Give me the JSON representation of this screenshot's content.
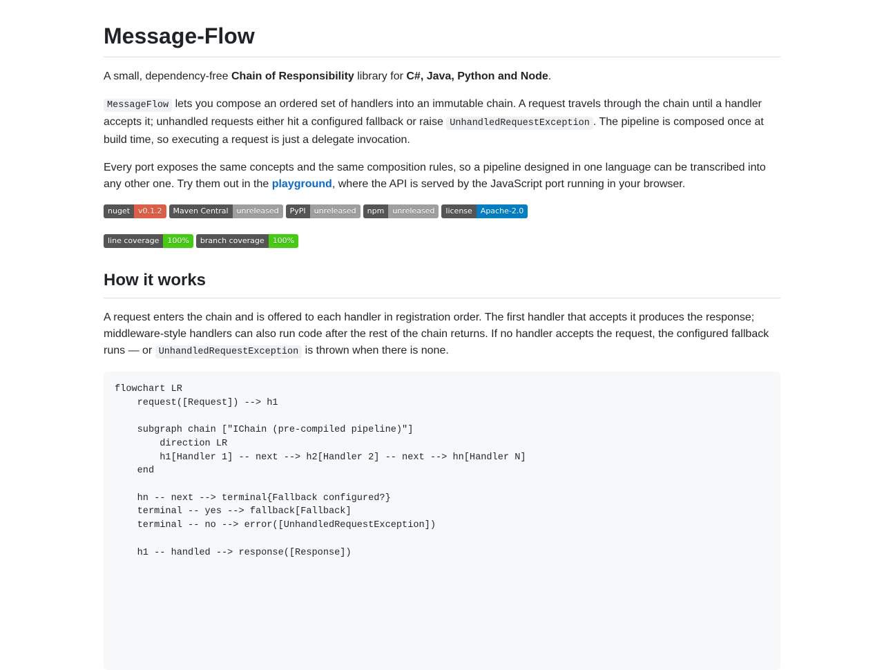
{
  "title": "Message-Flow",
  "intro": {
    "prefix": "A small, dependency-free ",
    "bold1": "Chain of Responsibility",
    "middle": " library for ",
    "bold2": "C#, Java, Python and Node",
    "suffix": "."
  },
  "para2": {
    "code1": "MessageFlow",
    "text1": " lets you compose an ordered set of handlers into an immutable chain. A request travels through the chain until a handler accepts it; unhandled requests either hit a configured fallback or raise ",
    "code2": "UnhandledRequestException",
    "text2": ". The pipeline is composed once at build time, so executing a request is just a delegate invocation."
  },
  "para3": {
    "text1": "Every port exposes the same concepts and the same composition rules, so a pipeline designed in one language can be transcribed into any other one. Try them out in the ",
    "link": "playground",
    "text2": ", where the API is served by the JavaScript port running in your browser."
  },
  "badges_row1": [
    {
      "label": "nuget",
      "value": "v0.1.2",
      "color": "#e05d44"
    },
    {
      "label": "Maven Central",
      "value": "unreleased",
      "color": "#9f9f9f"
    },
    {
      "label": "PyPI",
      "value": "unreleased",
      "color": "#9f9f9f"
    },
    {
      "label": "npm",
      "value": "unreleased",
      "color": "#9f9f9f"
    },
    {
      "label": "license",
      "value": "Apache-2.0",
      "color": "#007ec6"
    }
  ],
  "badges_row2": [
    {
      "label": "line coverage",
      "value": "100%",
      "color": "#4c1"
    },
    {
      "label": "branch coverage",
      "value": "100%",
      "color": "#4c1"
    }
  ],
  "section": {
    "heading": "How it works",
    "text1": "A request enters the chain and is offered to each handler in registration order. The first handler that accepts it produces the response; middleware-style handlers can also run code after the rest of the chain returns. If no handler accepts the request, the configured fallback runs — or ",
    "code": "UnhandledRequestException",
    "text2": " is thrown when there is none."
  },
  "code_block": "flowchart LR\n    request([Request]) --> h1\n\n    subgraph chain [\"IChain (pre-compiled pipeline)\"]\n        direction LR\n        h1[Handler 1] -- next --> h2[Handler 2] -- next --> hn[Handler N]\n    end\n\n    hn -- next --> terminal{Fallback configured?}\n    terminal -- yes --> fallback[Fallback]\n    terminal -- no --> error([UnhandledRequestException])\n\n    h1 -- handled --> response([Response])"
}
